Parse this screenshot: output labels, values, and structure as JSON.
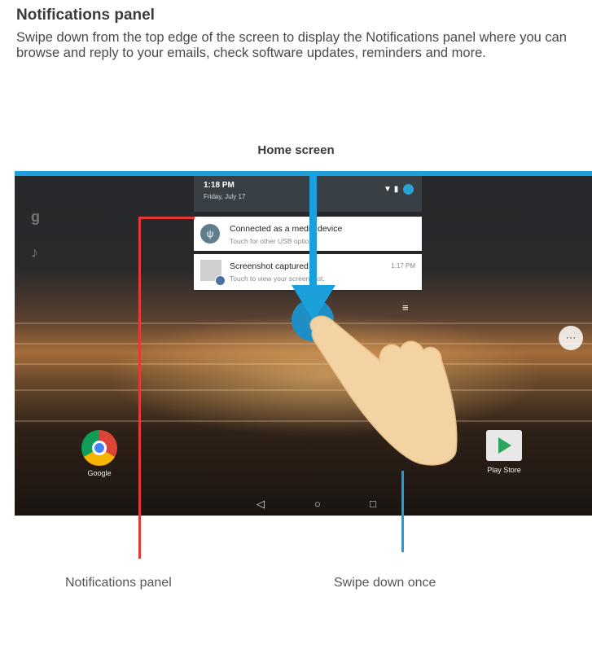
{
  "title": "Notifications panel",
  "description": "Swipe down from the top edge of the screen to display the Notifications panel where you can browse and reply to your emails, check software updates, reminders and more.",
  "home_screen_label": "Home screen",
  "panel": {
    "time": "1:18 PM",
    "date": "Friday, July 17",
    "notifications": [
      {
        "title": "Connected as a media device",
        "subtitle": "Touch for other USB options.",
        "time": ""
      },
      {
        "title": "Screenshot captured.",
        "subtitle": "Touch to view your screenshot.",
        "time": "1:17 PM"
      }
    ]
  },
  "apps": [
    {
      "label": "Google"
    },
    {
      "label": "Play Store"
    }
  ],
  "callouts": {
    "left": "Notifications panel",
    "right": "Swipe down once"
  },
  "colors": {
    "accent_blue": "#1ba0dc",
    "accent_red": "#e53935"
  }
}
